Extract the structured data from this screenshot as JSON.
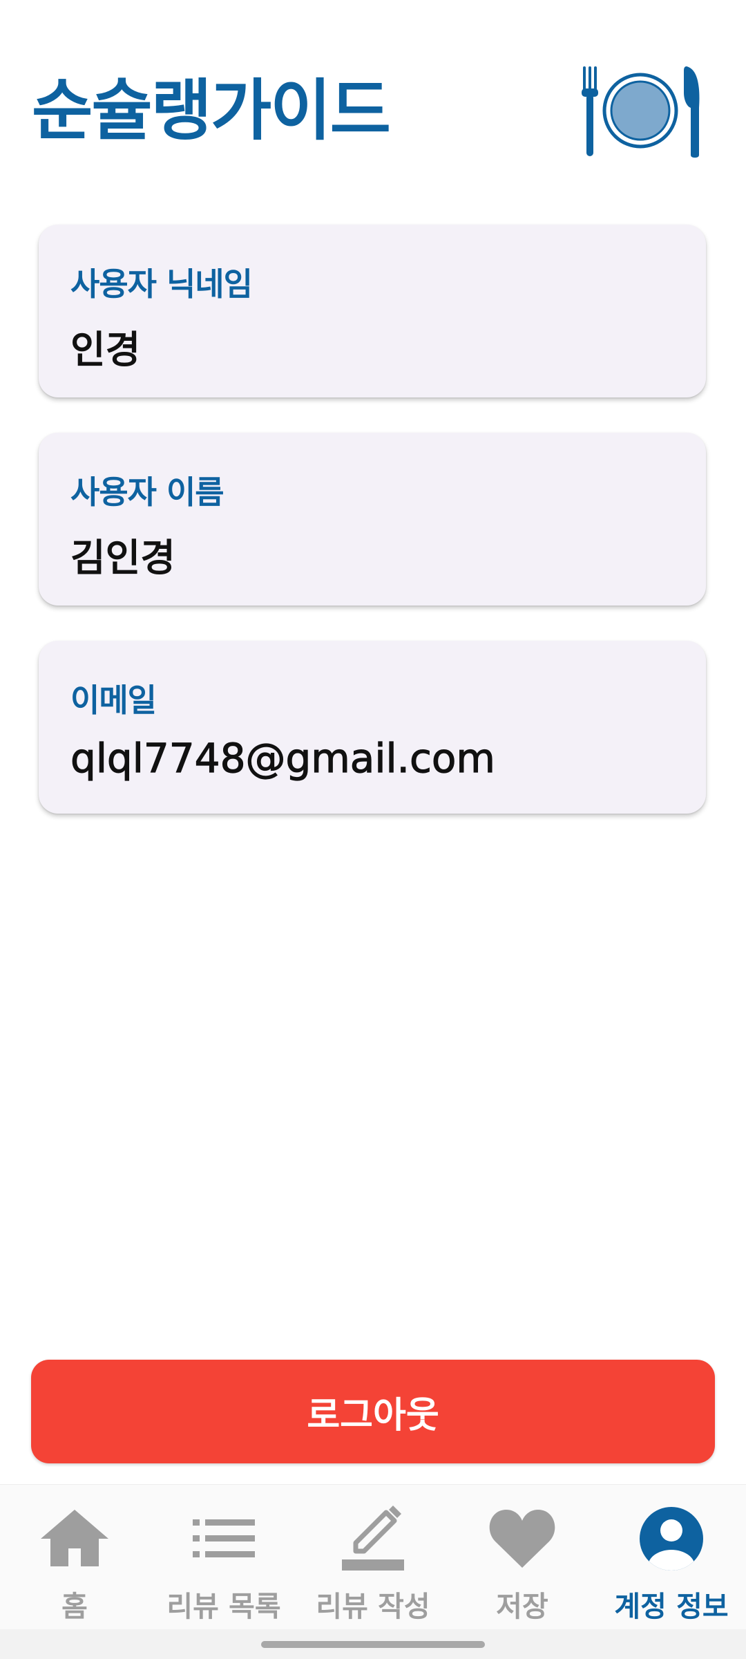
{
  "header": {
    "title": "순슐랭가이드",
    "logo_icon": "plate-fork-knife-icon"
  },
  "profile": {
    "nickname": {
      "label": "사용자 닉네임",
      "value": "인경"
    },
    "name": {
      "label": "사용자 이름",
      "value": "김인경"
    },
    "email": {
      "label": "이메일",
      "value": "qlql7748@gmail.com"
    }
  },
  "actions": {
    "logout_label": "로그아웃"
  },
  "bottom_nav": {
    "items": [
      {
        "label": "홈",
        "icon": "home-icon",
        "active": false
      },
      {
        "label": "리뷰 목록",
        "icon": "list-icon",
        "active": false
      },
      {
        "label": "리뷰 작성",
        "icon": "pencil-icon",
        "active": false
      },
      {
        "label": "저장",
        "icon": "heart-icon",
        "active": false
      },
      {
        "label": "계정 정보",
        "icon": "account-circle-icon",
        "active": true
      }
    ]
  },
  "colors": {
    "brand": "#0e62a0",
    "card_background": "#f4f1f8",
    "logout": "#f44336",
    "nav_inactive": "#9e9e9e"
  }
}
